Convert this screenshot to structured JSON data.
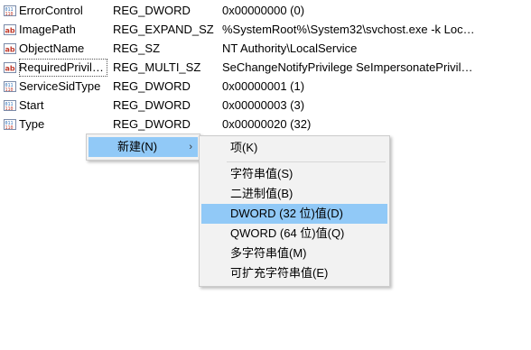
{
  "values": [
    {
      "icon": "reg-dword-icon",
      "name": "ErrorControl",
      "type": "REG_DWORD",
      "data": "0x00000000 (0)"
    },
    {
      "icon": "reg-string-icon",
      "name": "ImagePath",
      "type": "REG_EXPAND_SZ",
      "data": "%SystemRoot%\\System32\\svchost.exe -k Loc…"
    },
    {
      "icon": "reg-string-icon",
      "name": "ObjectName",
      "type": "REG_SZ",
      "data": "NT Authority\\LocalService"
    },
    {
      "icon": "reg-string-icon",
      "name": "RequiredPrivile…",
      "type": "REG_MULTI_SZ",
      "data": "SeChangeNotifyPrivilege SeImpersonatePrivil…"
    },
    {
      "icon": "reg-dword-icon",
      "name": "ServiceSidType",
      "type": "REG_DWORD",
      "data": "0x00000001 (1)"
    },
    {
      "icon": "reg-dword-icon",
      "name": "Start",
      "type": "REG_DWORD",
      "data": "0x00000003 (3)"
    },
    {
      "icon": "reg-dword-icon",
      "name": "Type",
      "type": "REG_DWORD",
      "data": "0x00000020 (32)"
    }
  ],
  "context_menu": {
    "new_label": "新建(N)",
    "arrow": "›"
  },
  "submenu": {
    "items": [
      {
        "label": "项(K)"
      },
      {
        "label": "字符串值(S)"
      },
      {
        "label": "二进制值(B)"
      },
      {
        "label": "DWORD (32 位)值(D)"
      },
      {
        "label": "QWORD (64 位)值(Q)"
      },
      {
        "label": "多字符串值(M)"
      },
      {
        "label": "可扩充字符串值(E)"
      }
    ],
    "highlighted_index": 3
  },
  "colors": {
    "highlight": "#91c9f7",
    "string_icon": "#c0392b",
    "dword_icon": "#2a6db5"
  }
}
